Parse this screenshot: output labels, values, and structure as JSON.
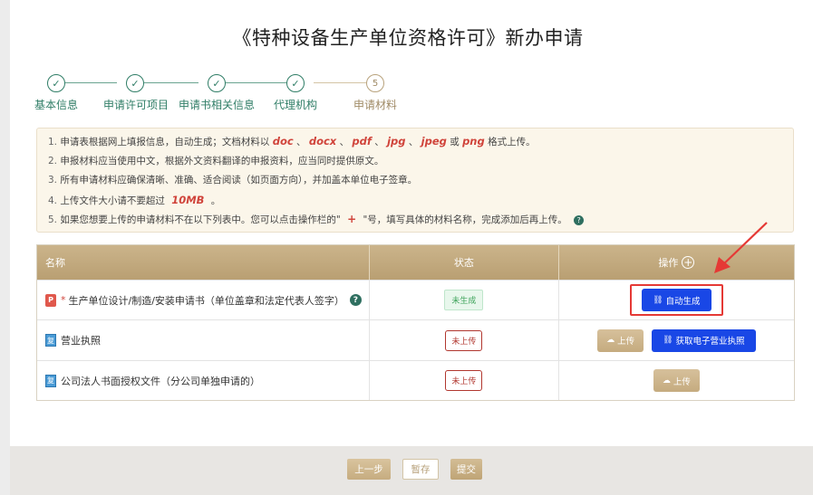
{
  "page": {
    "title": "《特种设备生产单位资格许可》新办申请"
  },
  "steps": [
    {
      "label": "基本信息",
      "state": "done",
      "mark": "✓"
    },
    {
      "label": "申请许可项目",
      "state": "done",
      "mark": "✓"
    },
    {
      "label": "申请书相关信息",
      "state": "done",
      "mark": "✓"
    },
    {
      "label": "代理机构",
      "state": "done",
      "mark": "✓"
    },
    {
      "label": "申请材料",
      "state": "current",
      "mark": "5"
    }
  ],
  "notice": {
    "l1_pre": "申请表根据网上填报信息，自动生成；文档材料以",
    "ext_doc": "doc",
    "ext_docx": "docx",
    "ext_pdf": "pdf",
    "ext_jpg": "jpg",
    "ext_jpeg": "jpeg",
    "ext_png": "png",
    "sep": "、",
    "or": "或",
    "l1_post": "格式上传。",
    "l2": "申报材料应当使用中文，根据外文资料翻译的申报资料，应当同时提供原文。",
    "l3": "所有申请材料应确保清晰、准确、适合阅读（如页面方向），并加盖本单位电子签章。",
    "l4_pre": "上传文件大小请不要超过",
    "l4_size": "10MB",
    "l4_post": "。",
    "l5_pre": "如果您想要上传的申请材料不在以下列表中。您可以点击操作栏的\"",
    "l5_plus": "+",
    "l5_post": "\"号，填写具体的材料名称，完成添加后再上传。",
    "n1": "1.",
    "n2": "2.",
    "n3": "3.",
    "n4": "4.",
    "n5": "5."
  },
  "table": {
    "headers": {
      "name": "名称",
      "status": "状态",
      "action": "操作"
    },
    "rows": [
      {
        "name": "生产单位设计/制造/安装申请书（单位盖章和法定代表人签字）",
        "required_mark": "*",
        "icon": "P",
        "status": "未生成",
        "actions": [
          "自动生成"
        ]
      },
      {
        "name": "营业执照",
        "icon": "复",
        "status": "未上传",
        "actions": [
          "上传",
          "获取电子营业执照"
        ]
      },
      {
        "name": "公司法人书面授权文件（分公司单独申请的）",
        "icon": "复",
        "status": "未上传",
        "actions": [
          "上传"
        ]
      }
    ]
  },
  "footer": {
    "prev": "上一步",
    "save": "暂存",
    "submit": "提交"
  },
  "colors": {
    "accent_green": "#2f7d66",
    "gold": "#c5ab7f",
    "primary_blue": "#1947e6",
    "highlight_red": "#e53935"
  }
}
